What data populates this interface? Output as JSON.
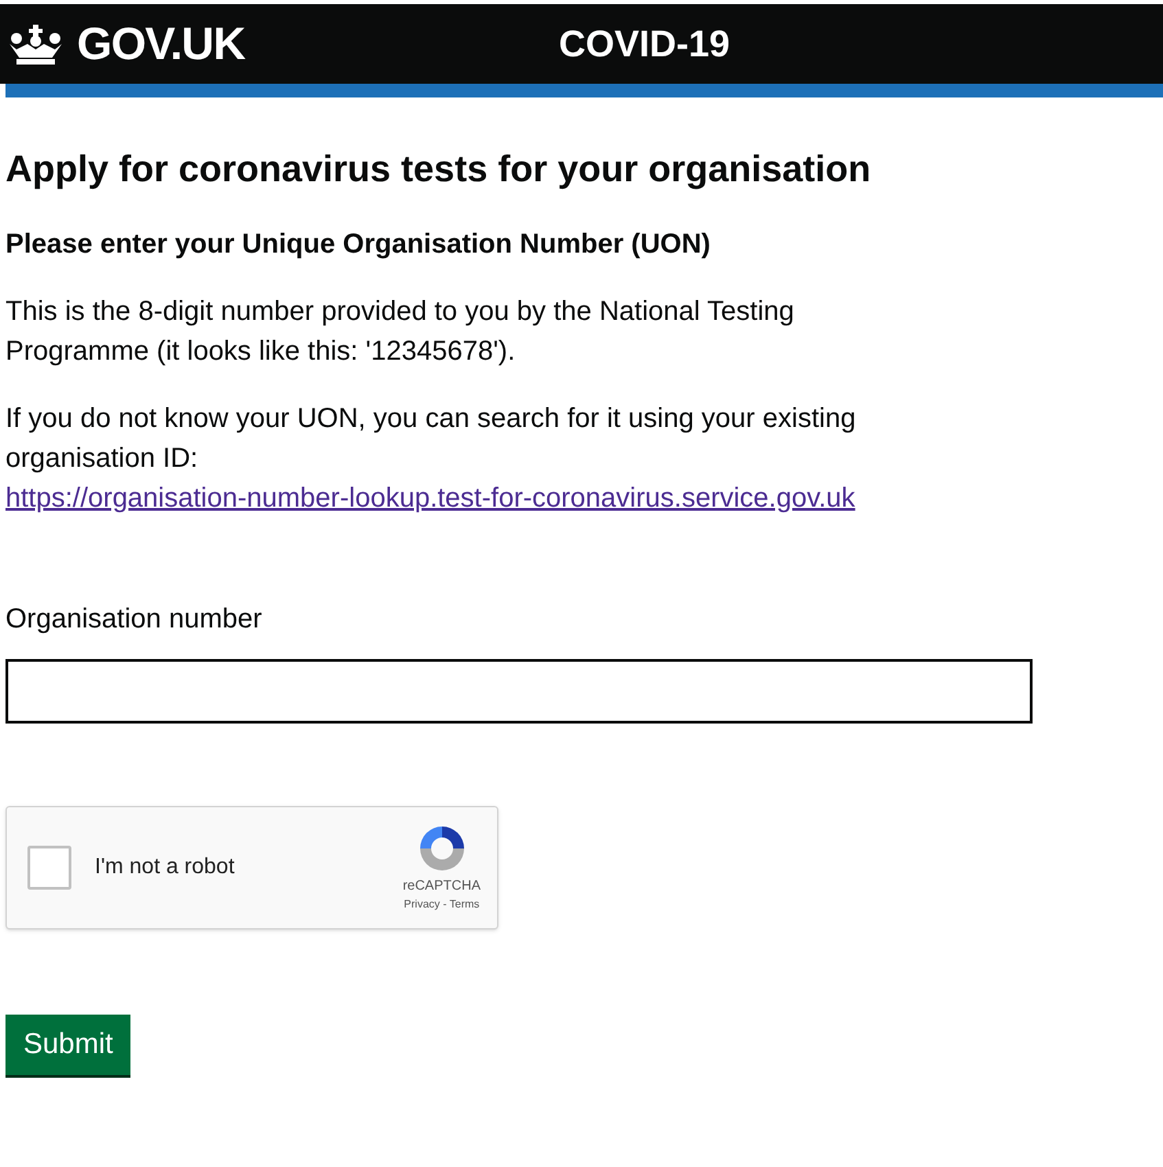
{
  "header": {
    "logo": "GOV.UK",
    "service": "COVID-19"
  },
  "title": "Apply for coronavirus tests for your organisation",
  "subtitle": "Please enter your Unique Organisation Number (UON)",
  "paragraphs": [
    {
      "text": "This is the 8-digit number provided to you by the National Testing Programme (it looks like this: '12345678')."
    },
    {
      "text": "If you do not know your UON, you can search for it using your existing organisation ID:",
      "link": "https://organisation-number-lookup.test-for-coronavirus.service.gov.uk"
    }
  ],
  "field": {
    "label": "Organisation number"
  },
  "captcha": {
    "label": "I'm not a robot",
    "checked": false,
    "brand": "reCAPTCHA",
    "links": "Privacy - Terms"
  },
  "submit": "Submit"
}
